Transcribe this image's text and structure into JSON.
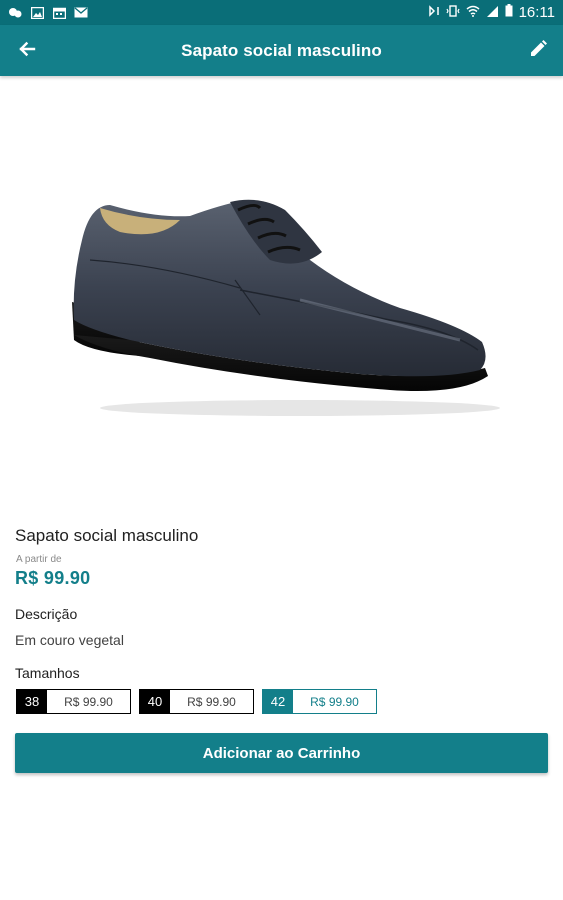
{
  "status_bar": {
    "time": "16:11",
    "left_icons": [
      "chat-icon",
      "image-icon",
      "calendar-icon",
      "email-icon"
    ],
    "right_icons": [
      "nfc-icon",
      "vibrate-icon",
      "wifi-icon",
      "signal-icon",
      "battery-icon"
    ]
  },
  "app_bar": {
    "title": "Sapato social masculino",
    "back_icon": "arrow-left-icon",
    "edit_icon": "pencil-icon",
    "background": "#137f8a"
  },
  "product": {
    "name": "Sapato social masculino",
    "price_prefix": "A partir de",
    "price": "R$ 99.90",
    "description_title": "Descrição",
    "description": "Em couro vegetal",
    "sizes_title": "Tamanhos",
    "sizes": [
      {
        "size": "38",
        "price": "R$ 99.90",
        "selected": false
      },
      {
        "size": "40",
        "price": "R$ 99.90",
        "selected": false
      },
      {
        "size": "42",
        "price": "R$ 99.90",
        "selected": true
      }
    ]
  },
  "actions": {
    "add_to_cart": "Adicionar ao Carrinho"
  },
  "colors": {
    "primary": "#137f8a",
    "status_bar": "#0a6e78",
    "selected_size": "#137f8a",
    "unselected_size": "#000000"
  }
}
